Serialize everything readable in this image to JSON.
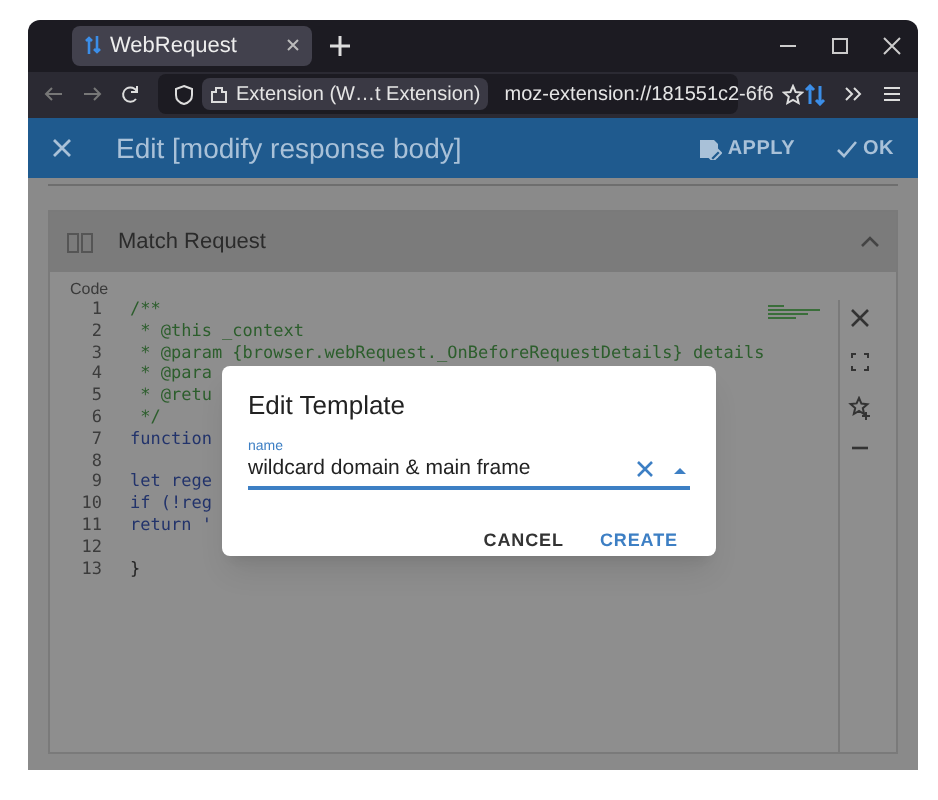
{
  "browser": {
    "tabs": [
      {
        "title": "WebRequest",
        "selected": true
      }
    ],
    "identity_label": "Extension (W…t Extension)",
    "url": "moz-extension://181551c2-6f6"
  },
  "app_bar": {
    "title": "Edit [modify response body]",
    "actions": [
      "APPLY",
      "OK"
    ]
  },
  "section": {
    "title": "Match Request",
    "expanded": true
  },
  "code": {
    "label": "Code",
    "lines": [
      {
        "number": "1",
        "text": "/**",
        "kind": "comment"
      },
      {
        "number": "2",
        "text": " * @this _context",
        "kind": "comment"
      },
      {
        "number": "3",
        "text": " * @param {browser.webRequest._OnBeforeRequestDetails} details",
        "kind": "comment"
      },
      {
        "number": "4",
        "text": " * @para",
        "kind": "comment"
      },
      {
        "number": "5",
        "text": " * @retu",
        "kind": "comment"
      },
      {
        "number": "6",
        "text": " */",
        "kind": "comment"
      },
      {
        "number": "7",
        "text": "function",
        "kind": "keyword"
      },
      {
        "number": "8"
      },
      {
        "number": "9",
        "text": "let rege",
        "kind": "keyword"
      },
      {
        "number": "10",
        "text": "if (!reg",
        "kind": "keyword"
      },
      {
        "number": "11",
        "text": "return '",
        "kind": "keyword"
      },
      {
        "number": "12"
      },
      {
        "number": "13",
        "text": "}",
        "kind": "plain"
      }
    ]
  },
  "dialog": {
    "title": "Edit Template",
    "field": {
      "label": "name",
      "value": "wildcard domain & main frame"
    },
    "buttons": [
      {
        "label": "CANCEL",
        "primary": false
      },
      {
        "label": "CREATE",
        "primary": true
      }
    ]
  }
}
